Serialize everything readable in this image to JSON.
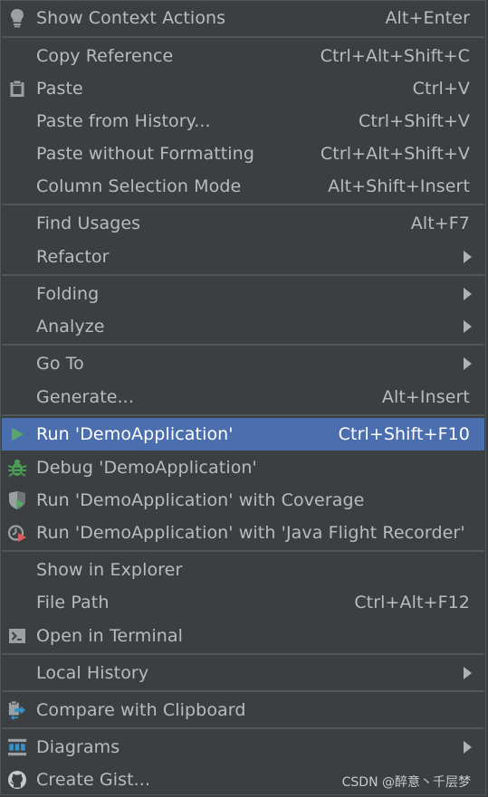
{
  "menu": {
    "items": [
      {
        "name": "show-context-actions",
        "label": "Show Context Actions",
        "shortcut": "Alt+Enter",
        "icon": "lightbulb-icon"
      },
      {
        "name": "copy-reference",
        "label": "Copy Reference",
        "shortcut": "Ctrl+Alt+Shift+C"
      },
      {
        "name": "paste",
        "label": "Paste",
        "shortcut": "Ctrl+V",
        "icon": "clipboard-icon"
      },
      {
        "name": "paste-from-history",
        "label": "Paste from History...",
        "shortcut": "Ctrl+Shift+V"
      },
      {
        "name": "paste-without-formatting",
        "label": "Paste without Formatting",
        "shortcut": "Ctrl+Alt+Shift+V"
      },
      {
        "name": "column-selection-mode",
        "label": "Column Selection Mode",
        "shortcut": "Alt+Shift+Insert"
      },
      {
        "name": "find-usages",
        "label": "Find Usages",
        "shortcut": "Alt+F7"
      },
      {
        "name": "refactor",
        "label": "Refactor",
        "submenu": true
      },
      {
        "name": "folding",
        "label": "Folding",
        "submenu": true
      },
      {
        "name": "analyze",
        "label": "Analyze",
        "submenu": true
      },
      {
        "name": "go-to",
        "label": "Go To",
        "submenu": true
      },
      {
        "name": "generate",
        "label": "Generate...",
        "shortcut": "Alt+Insert"
      },
      {
        "name": "run-demo",
        "label": "Run 'DemoApplication'",
        "shortcut": "Ctrl+Shift+F10",
        "icon": "run-icon",
        "selected": true
      },
      {
        "name": "debug-demo",
        "label": "Debug 'DemoApplication'",
        "icon": "bug-icon"
      },
      {
        "name": "run-coverage",
        "label": "Run 'DemoApplication' with Coverage",
        "icon": "coverage-icon"
      },
      {
        "name": "run-jfr",
        "label": "Run 'DemoApplication' with 'Java Flight Recorder'",
        "icon": "profiler-icon"
      },
      {
        "name": "show-in-explorer",
        "label": "Show in Explorer"
      },
      {
        "name": "file-path",
        "label": "File Path",
        "shortcut": "Ctrl+Alt+F12"
      },
      {
        "name": "open-in-terminal",
        "label": "Open in Terminal",
        "icon": "terminal-icon"
      },
      {
        "name": "local-history",
        "label": "Local History",
        "submenu": true
      },
      {
        "name": "compare-with-clipboard",
        "label": "Compare with Clipboard",
        "icon": "compare-icon"
      },
      {
        "name": "diagrams",
        "label": "Diagrams",
        "submenu": true,
        "icon": "diagram-icon"
      },
      {
        "name": "create-gist",
        "label": "Create Gist...",
        "icon": "github-icon"
      }
    ]
  },
  "watermark": "CSDN @醉意丶千层梦",
  "colors": {
    "background": "#3c3f41",
    "selection": "#4b6eaf",
    "separator": "#515658",
    "text": "#bbbbbb"
  }
}
